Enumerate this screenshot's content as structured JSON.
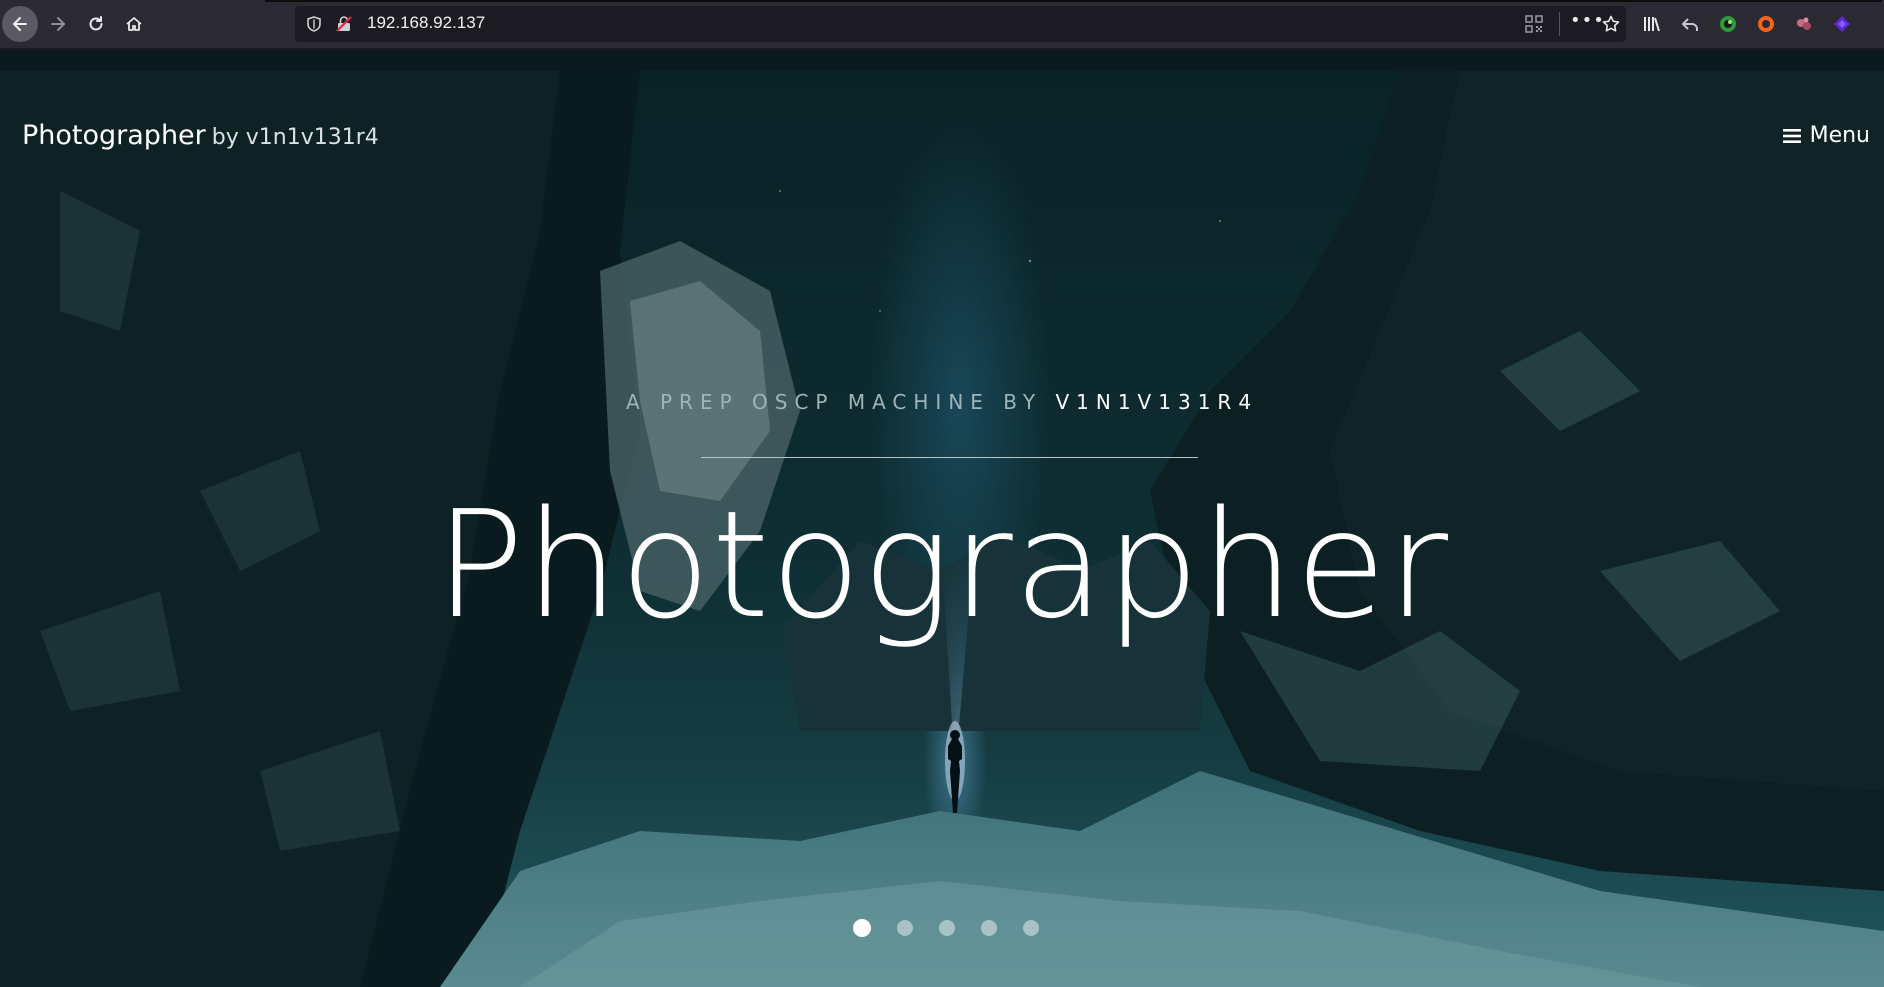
{
  "browser": {
    "url": "192.168.92.137",
    "more_label": "•••",
    "icons": [
      "back-icon",
      "forward-icon",
      "reload-icon",
      "home-icon",
      "shield-icon",
      "insecure-lock-icon",
      "qr-code-icon",
      "more-icon",
      "bookmark-star-icon",
      "library-icon",
      "undo-icon",
      "extension-green-icon",
      "extension-orange-icon",
      "extension-pink-icon",
      "extension-purple-icon"
    ]
  },
  "site": {
    "brand": "Photographer",
    "brand_by": "by v1n1v131r4",
    "menu_label": "Menu"
  },
  "hero": {
    "subtitle_prefix": "A PREP OSCP MACHINE BY ",
    "subtitle_author": "V1N1V131R4",
    "title": "Photographer",
    "slides": [
      {
        "active": true
      },
      {
        "active": false
      },
      {
        "active": false
      },
      {
        "active": false
      },
      {
        "active": false
      }
    ]
  },
  "colors": {
    "toolbar_bg": "#2b2a33",
    "urlbar_bg": "#1c1b22",
    "hero_text": "#ffffff",
    "subtitle_text": "#9fb4b8"
  }
}
